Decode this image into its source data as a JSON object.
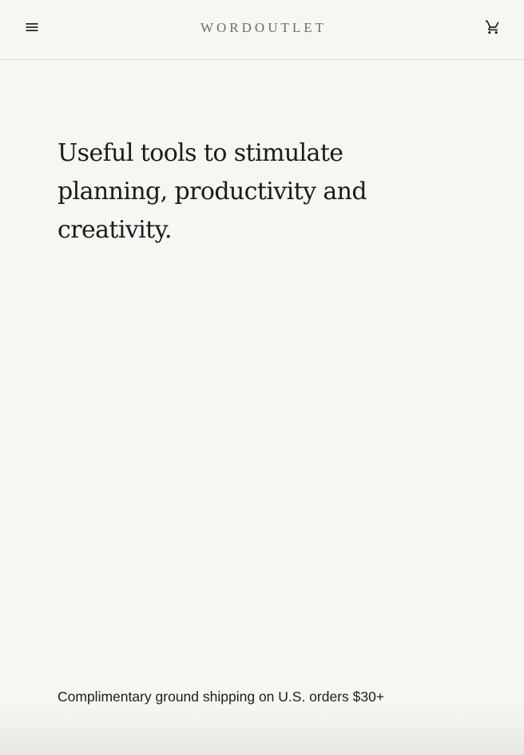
{
  "header": {
    "brand": "WORDOUTLET",
    "menu_icon": "menu-icon",
    "cart_icon": "cart-icon"
  },
  "hero": {
    "headline": "Useful tools to stimulate planning, productivity and creativity."
  },
  "footer": {
    "shipping_notice": "Complimentary ground shipping on U.S. orders $30+"
  },
  "colors": {
    "background": "#f7f6f2",
    "text": "#1b1b1b",
    "brand": "#6c6c6a",
    "divider": "#dad9d5"
  }
}
